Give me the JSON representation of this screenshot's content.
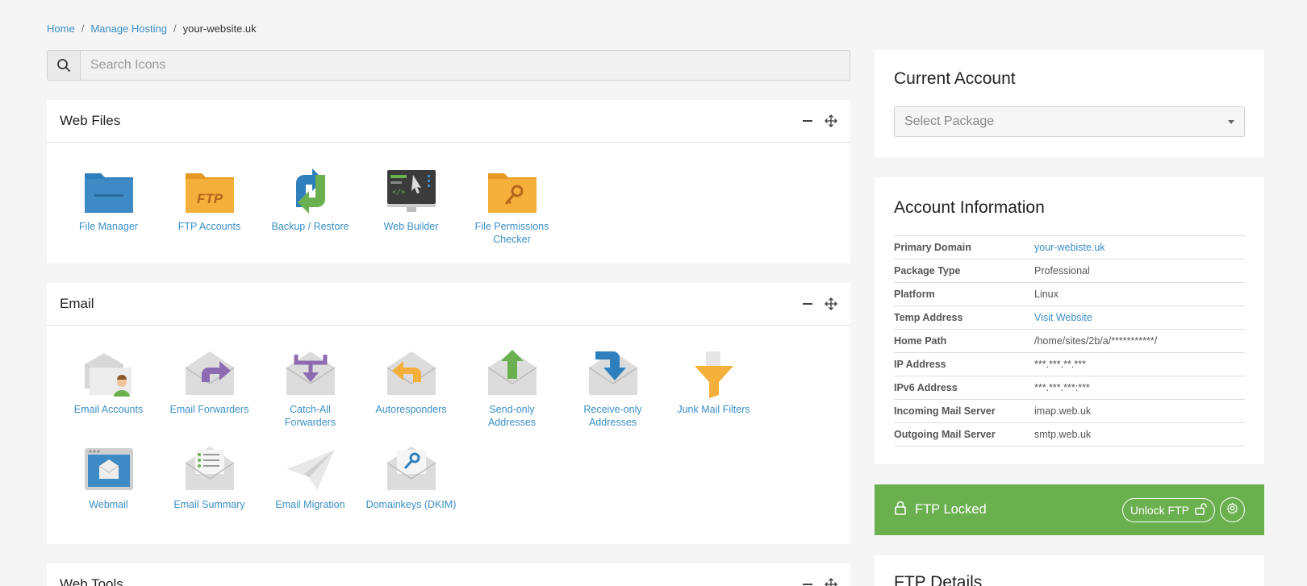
{
  "breadcrumb": {
    "home": "Home",
    "manage": "Manage Hosting",
    "current": "your-website.uk"
  },
  "search": {
    "placeholder": "Search Icons"
  },
  "web_files": {
    "title": "Web Files",
    "items": [
      "File Manager",
      "FTP Accounts",
      "Backup / Restore",
      "Web Builder",
      "File Permissions Checker"
    ]
  },
  "email": {
    "title": "Email",
    "items": [
      "Email Accounts",
      "Email Forwarders",
      "Catch-All Forwarders",
      "Autoresponders",
      "Send-only Addresses",
      "Receive-only Addresses",
      "Junk Mail Filters",
      "Webmail",
      "Email Summary",
      "Email Migration",
      "Domainkeys (DKIM)"
    ]
  },
  "web_tools": {
    "title": "Web Tools"
  },
  "current_account": {
    "title": "Current Account",
    "select_placeholder": "Select Package"
  },
  "account_info": {
    "title": "Account Information",
    "rows": [
      {
        "k": "Primary Domain",
        "v": "your-webiste.uk"
      },
      {
        "k": "Package Type",
        "v": "Professional"
      },
      {
        "k": "Platform",
        "v": "Linux"
      },
      {
        "k": "Temp Address",
        "v": "Visit Website"
      },
      {
        "k": "Home Path",
        "v": "/home/sites/2b/a/***********/"
      },
      {
        "k": "IP Address",
        "v": "***.***.**.***"
      },
      {
        "k": "IPv6 Address",
        "v": "***.***.***:***"
      },
      {
        "k": "Incoming Mail Server",
        "v": "imap.web.uk"
      },
      {
        "k": "Outgoing Mail Server",
        "v": "smtp.web.uk"
      }
    ]
  },
  "ftp": {
    "status": "FTP Locked",
    "unlock_label": "Unlock FTP"
  },
  "ftp_details": {
    "title": "FTP Details"
  },
  "colors": {
    "link": "#3a8fc7",
    "ftp_green": "#6ab04f",
    "folder_blue": "#3d8ac4",
    "folder_orange": "#f5b03c"
  }
}
